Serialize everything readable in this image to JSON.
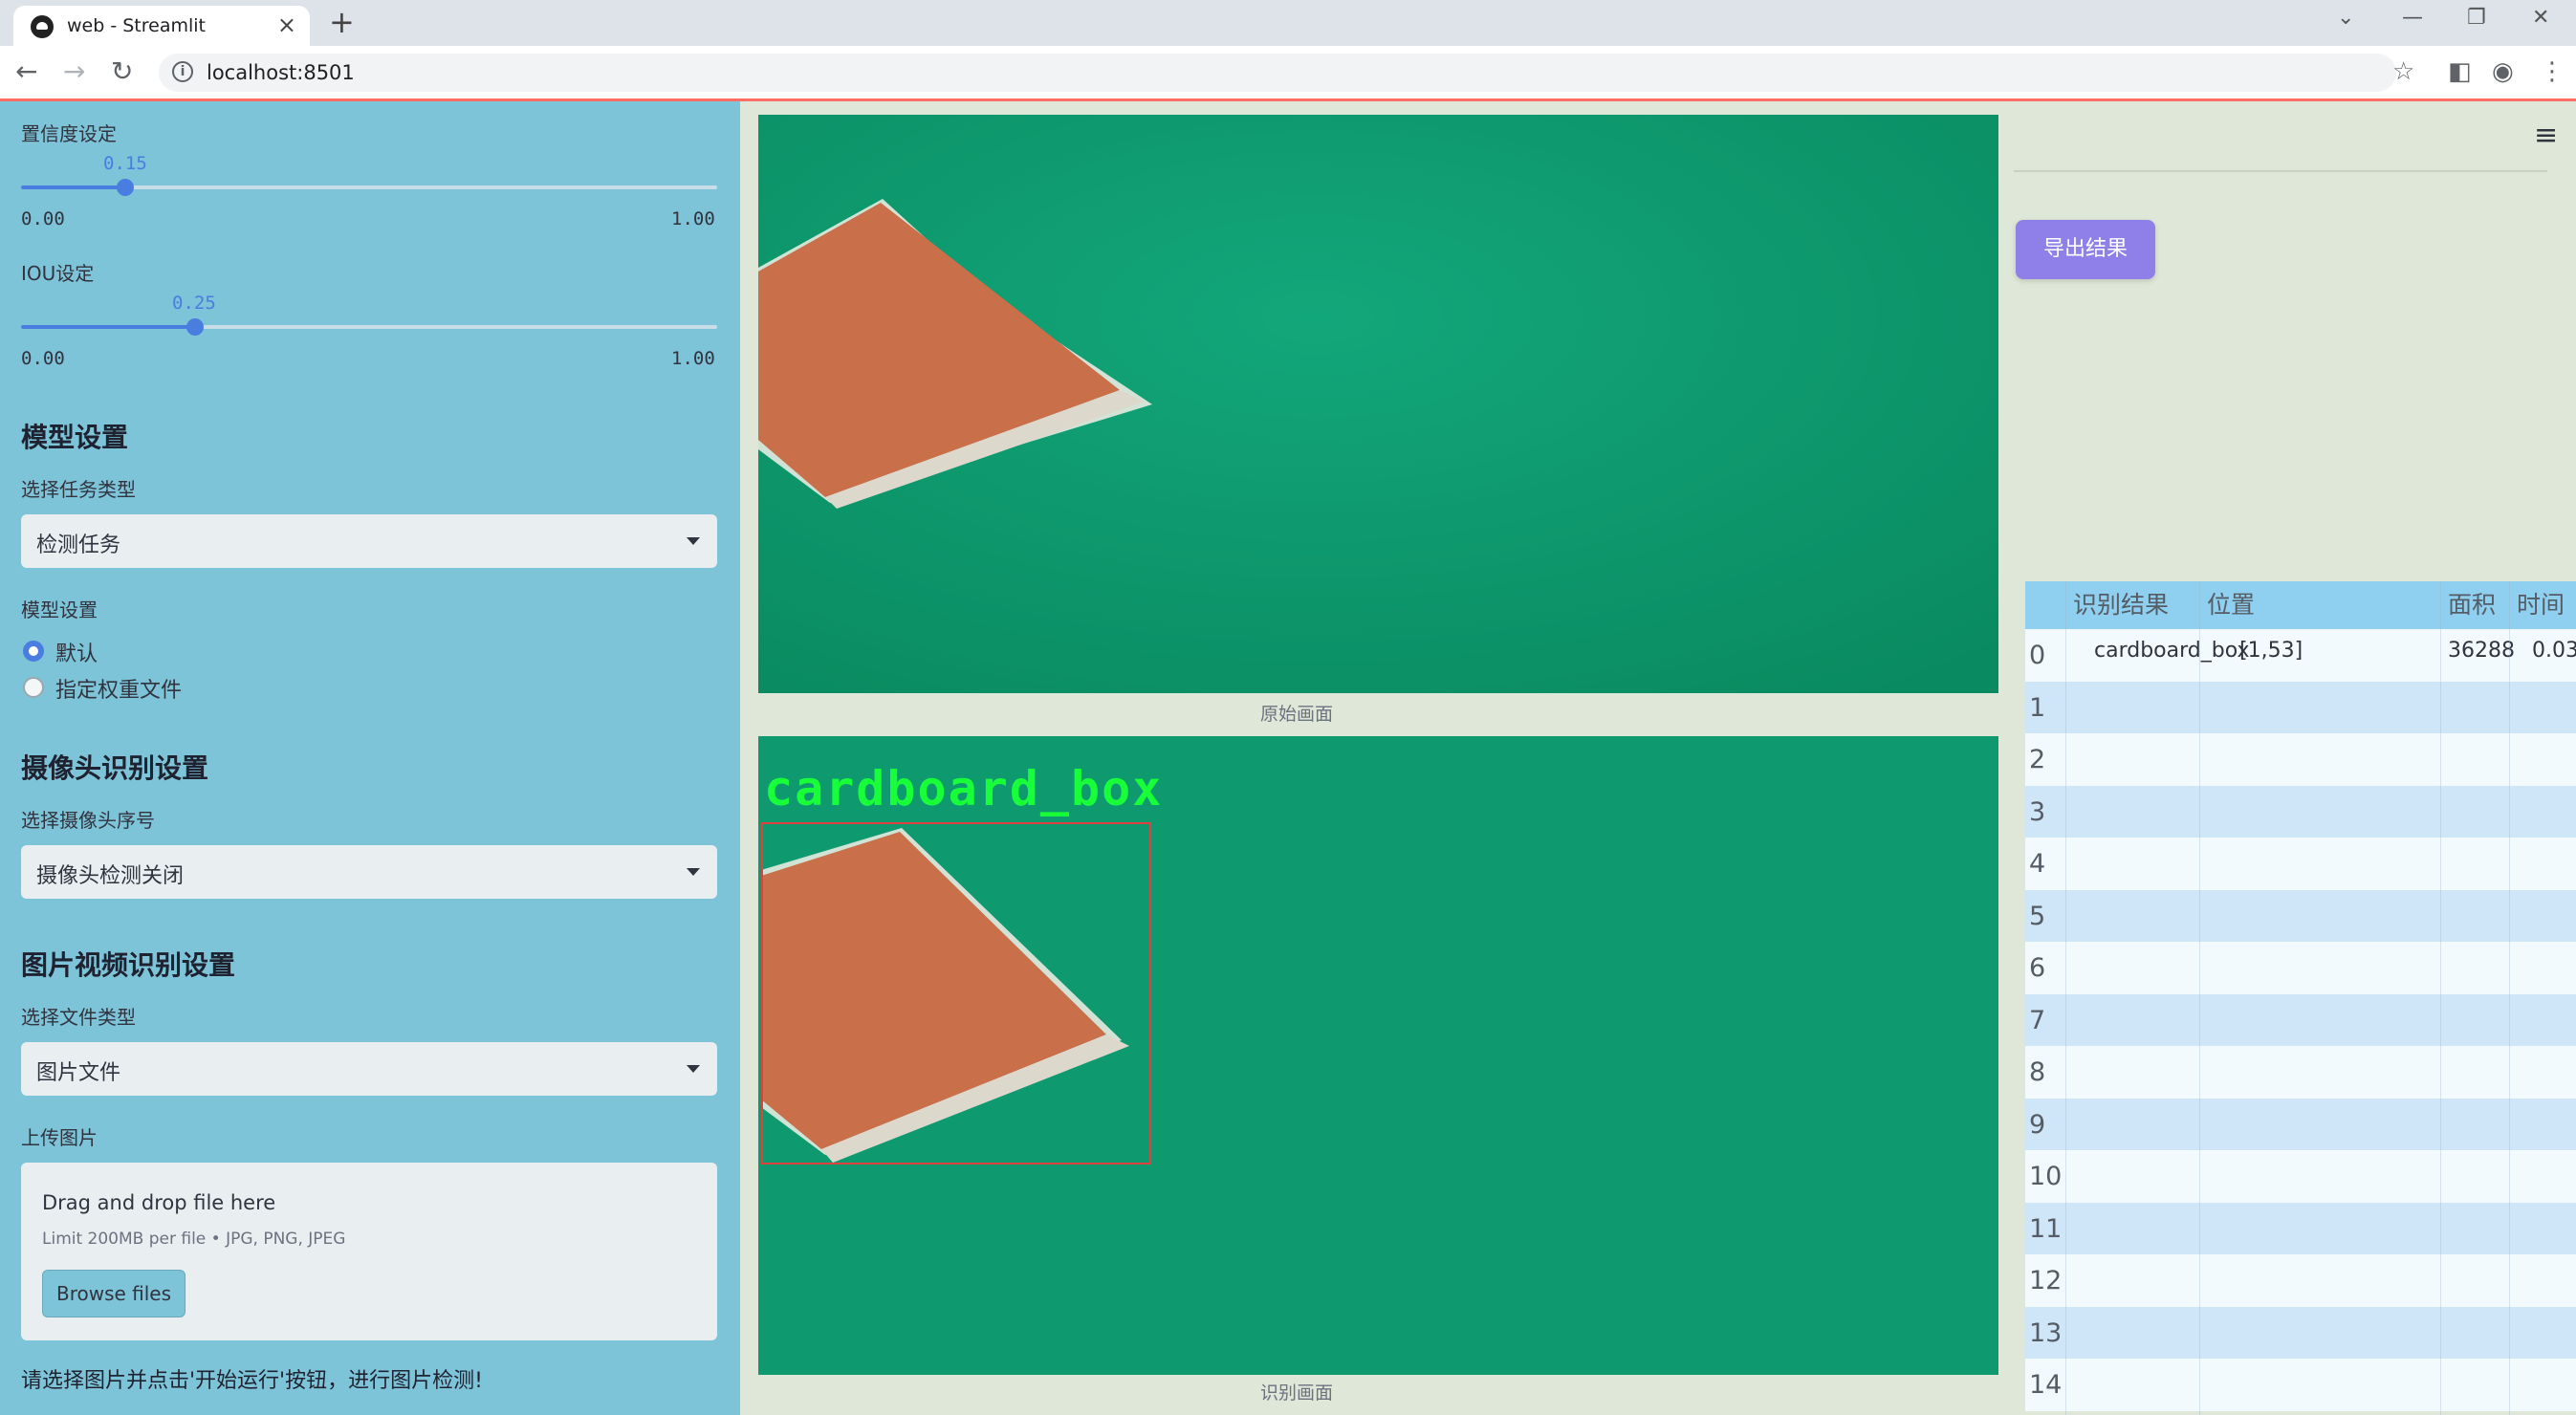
{
  "browser": {
    "tab_title": "web - Streamlit",
    "url": "localhost:8501"
  },
  "sidebar": {
    "confidence": {
      "label": "置信度设定",
      "value": "0.15",
      "value_fraction": 0.15,
      "min": "0.00",
      "max": "1.00"
    },
    "iou": {
      "label": "IOU设定",
      "value": "0.25",
      "value_fraction": 0.25,
      "min": "0.00",
      "max": "1.00"
    },
    "model_heading": "模型设置",
    "task_label": "选择任务类型",
    "task_value": "检测任务",
    "model_label": "模型设置",
    "model_options": [
      {
        "label": "默认",
        "checked": true
      },
      {
        "label": "指定权重文件",
        "checked": false
      }
    ],
    "camera_heading": "摄像头识别设置",
    "camera_label": "选择摄像头序号",
    "camera_value": "摄像头检测关闭",
    "media_heading": "图片视频识别设置",
    "filetype_label": "选择文件类型",
    "filetype_value": "图片文件",
    "upload_label": "上传图片",
    "upload": {
      "title": "Drag and drop file here",
      "limit": "Limit 200MB per file • JPG, PNG, JPEG",
      "button": "Browse files"
    },
    "hint": "请选择图片并点击'开始运行'按钮，进行图片检测!"
  },
  "main": {
    "original_caption": "原始画面",
    "result_caption": "识别画面",
    "detection_label": "cardboard_box"
  },
  "right": {
    "export_button": "导出结果",
    "table": {
      "columns": [
        "识别结果",
        "位置",
        "面积",
        "时间"
      ],
      "rows": [
        {
          "index": "0",
          "result": "cardboard_box",
          "position": "[1,53]",
          "area": "36288",
          "time": "0.03"
        },
        {
          "index": "1",
          "result": "",
          "position": "",
          "area": "",
          "time": ""
        },
        {
          "index": "2",
          "result": "",
          "position": "",
          "area": "",
          "time": ""
        },
        {
          "index": "3",
          "result": "",
          "position": "",
          "area": "",
          "time": ""
        },
        {
          "index": "4",
          "result": "",
          "position": "",
          "area": "",
          "time": ""
        },
        {
          "index": "5",
          "result": "",
          "position": "",
          "area": "",
          "time": ""
        },
        {
          "index": "6",
          "result": "",
          "position": "",
          "area": "",
          "time": ""
        },
        {
          "index": "7",
          "result": "",
          "position": "",
          "area": "",
          "time": ""
        },
        {
          "index": "8",
          "result": "",
          "position": "",
          "area": "",
          "time": ""
        },
        {
          "index": "9",
          "result": "",
          "position": "",
          "area": "",
          "time": ""
        },
        {
          "index": "10",
          "result": "",
          "position": "",
          "area": "",
          "time": ""
        },
        {
          "index": "11",
          "result": "",
          "position": "",
          "area": "",
          "time": ""
        },
        {
          "index": "12",
          "result": "",
          "position": "",
          "area": "",
          "time": ""
        },
        {
          "index": "13",
          "result": "",
          "position": "",
          "area": "",
          "time": ""
        },
        {
          "index": "14",
          "result": "",
          "position": "",
          "area": "",
          "time": ""
        }
      ]
    }
  },
  "colors": {
    "sidebar_bg": "#7ec4d8",
    "accent": "#4a7de0",
    "export_button": "#8f7fe8",
    "canvas_green": "#0e9a6e",
    "detection_green": "#18ff3a",
    "box_red": "#e04040"
  }
}
